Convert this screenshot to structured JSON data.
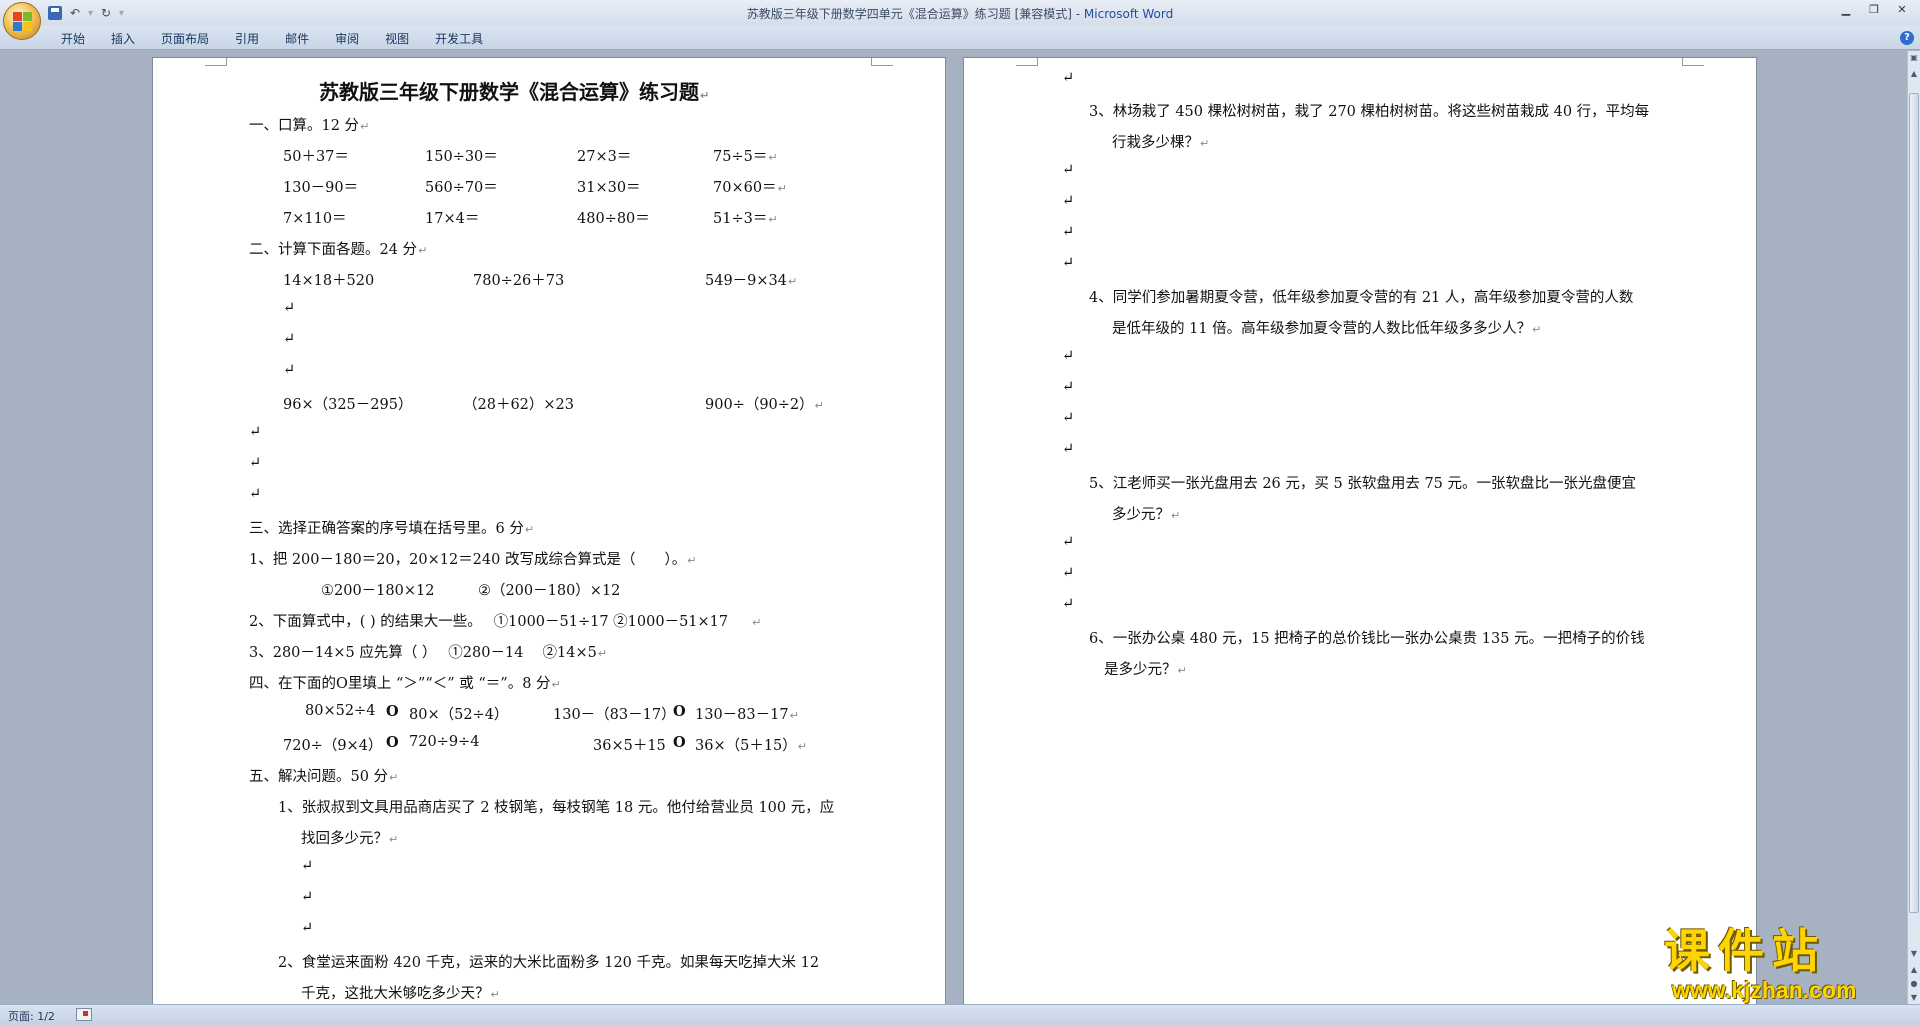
{
  "window": {
    "title": "苏教版三年级下册数学四单元《混合运算》练习题 [兼容模式] - ",
    "app_name": "Microsoft Word"
  },
  "icons": {
    "office_button": "office-logo-icon",
    "save": "save-icon",
    "undo": "undo-icon",
    "redo": "redo-icon",
    "customize": "qat-dropdown-icon",
    "minimize": "minimize-icon",
    "restore": "restore-icon",
    "close": "close-icon",
    "help": "help-icon"
  },
  "ribbon": {
    "tabs": [
      "开始",
      "插入",
      "页面布局",
      "引用",
      "邮件",
      "审阅",
      "视图",
      "开发工具"
    ],
    "help": "?"
  },
  "page1": {
    "title": "苏教版三年级下册数学《混合运算》练习题",
    "sec1": "一、口算。12 分",
    "oral": [
      [
        "50＋37＝",
        "150÷30＝",
        "27×3＝",
        "75÷5＝"
      ],
      [
        "130－90＝",
        "560÷70＝",
        "31×30＝",
        "70×60＝"
      ],
      [
        "7×110＝",
        "17×4＝",
        "480÷80＝",
        "51÷3＝"
      ]
    ],
    "sec2": "二、计算下面各题。24 分",
    "calc_row1": [
      "14×18＋520",
      "780÷26＋73",
      "549－9×34"
    ],
    "calc_row2": [
      "96×（325－295）",
      "（28＋62）×23",
      "900÷（90÷2）"
    ],
    "sec3": "三、选择正确答案的序号填在括号里。6 分",
    "q3_1": "1、把 200－180＝20，20×12＝240 改写成综合算式是（　　）。",
    "q3_1_opts": "①200－180×12　　　②（200－180）×12",
    "q3_2": "2、下面算式中，( ) 的结果大一些。　 ①1000－51÷17 ②1000－51×17",
    "q3_3": "3、280－14×5 应先算（ ）　 ①280－14　 ②14×5",
    "sec4": "四、在下面的O里填上 “＞”“＜” 或 “＝”。8 分",
    "cmp_row1": [
      "80×52÷4",
      "O",
      "80×（52÷4）",
      "130－（83－17）",
      "O",
      "130－83－17"
    ],
    "cmp_row2": [
      "720÷（9×4）",
      "O",
      "720÷9÷4",
      "36×5＋15",
      "O",
      "36×（5＋15）"
    ],
    "sec5": "五、解决问题。50 分",
    "p1_a": "1、张叔叔到文具用品商店买了 2 枝钢笔，每枝钢笔 18 元。他付给营业员 100 元，应",
    "p1_b": "找回多少元？",
    "p2_a": "2、食堂运来面粉 420 千克，运来的大米比面粉多 120 千克。如果每天吃掉大米 12",
    "p2_b": "千克，这批大米够吃多少天？"
  },
  "page2": {
    "p3_a": "3、林场栽了 450 棵松树树苗，栽了 270 棵柏树树苗。将这些树苗栽成 40 行，平均每",
    "p3_b": "行栽多少棵？",
    "p4_a": "4、同学们参加暑期夏令营，低年级参加夏令营的有 21 人，高年级参加夏令营的人数",
    "p4_b": "是低年级的 11 倍。高年级参加夏令营的人数比低年级多多少人？",
    "p5_a": "5、江老师买一张光盘用去 26 元，买 5 张软盘用去 75 元。一张软盘比一张光盘便宜",
    "p5_b": "多少元？",
    "p6_a": "6、一张办公桌 480 元，15 把椅子的总价钱比一张办公桌贵 135 元。一把椅子的价钱",
    "p6_b": "是多少元？"
  },
  "status": {
    "page": "页面: 1/2"
  },
  "watermark": {
    "cn": "课件站",
    "url": "www.kjzhan.com"
  },
  "marks": {
    "para": "↵"
  },
  "colors": {
    "app_name": "#1f4e9c",
    "watermark": "#ffd400",
    "workspace": "#a6b1c2"
  }
}
